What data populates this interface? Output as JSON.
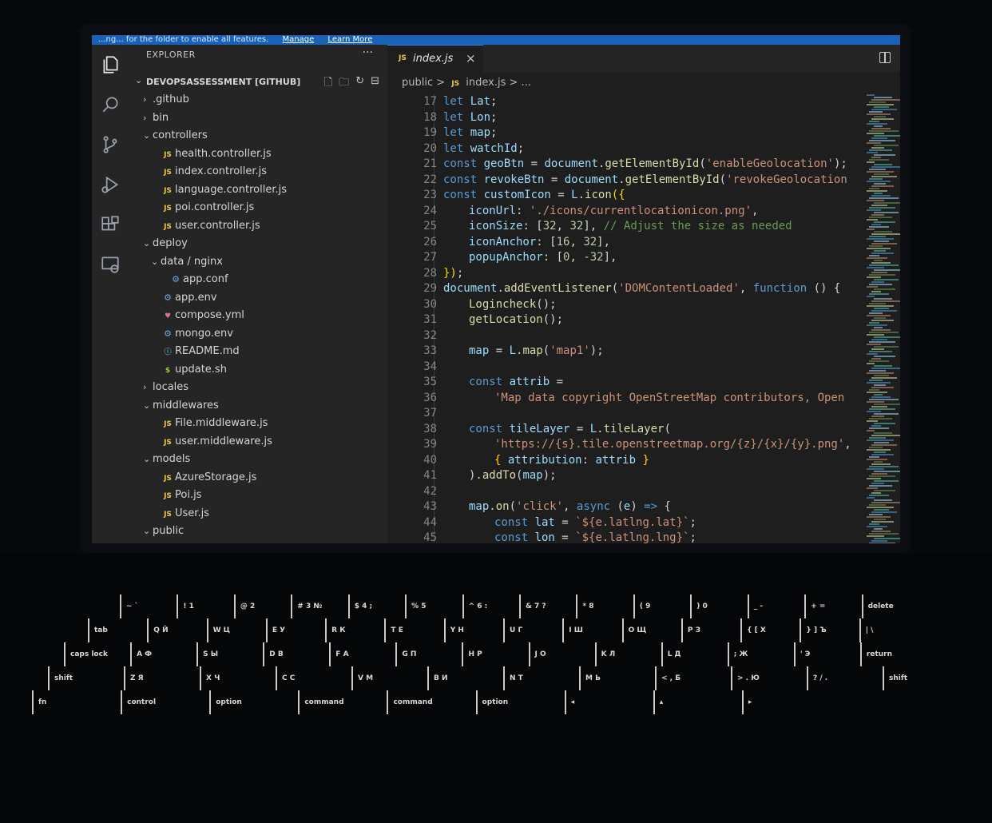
{
  "notice": {
    "message": "...ng... for the folder to enable all features.",
    "manage_link": "Manage",
    "learn_link": "Learn More"
  },
  "activity_bar": {
    "icons": [
      "files-icon",
      "search-icon",
      "source-control-icon",
      "run-debug-icon",
      "extensions-icon",
      "remote-explorer-icon"
    ]
  },
  "explorer": {
    "title": "EXPLORER",
    "more": "···",
    "repo": "DEVOPSASSESSMENT [GITHUB]",
    "tree": [
      {
        "depth": 1,
        "chevron": "›",
        "icon": "",
        "label": ".github"
      },
      {
        "depth": 1,
        "chevron": "›",
        "icon": "",
        "label": "bin"
      },
      {
        "depth": 1,
        "chevron": "⌄",
        "icon": "",
        "label": "controllers"
      },
      {
        "depth": 2,
        "chevron": "",
        "icon": "JS",
        "label": "health.controller.js"
      },
      {
        "depth": 2,
        "chevron": "",
        "icon": "JS",
        "label": "index.controller.js"
      },
      {
        "depth": 2,
        "chevron": "",
        "icon": "JS",
        "label": "language.controller.js"
      },
      {
        "depth": 2,
        "chevron": "",
        "icon": "JS",
        "label": "poi.controller.js"
      },
      {
        "depth": 2,
        "chevron": "",
        "icon": "JS",
        "label": "user.controller.js"
      },
      {
        "depth": 1,
        "chevron": "⌄",
        "icon": "",
        "label": "deploy"
      },
      {
        "depth": 2,
        "chevron": "⌄",
        "icon": "",
        "label": "data / nginx"
      },
      {
        "depth": 3,
        "chevron": "",
        "icon": "⚙",
        "label": "app.conf"
      },
      {
        "depth": 2,
        "chevron": "",
        "icon": "⚙",
        "label": "app.env"
      },
      {
        "depth": 2,
        "chevron": "",
        "icon": "♥",
        "label": "compose.yml"
      },
      {
        "depth": 2,
        "chevron": "",
        "icon": "⚙",
        "label": "mongo.env"
      },
      {
        "depth": 2,
        "chevron": "",
        "icon": "ⓘ",
        "label": "README.md"
      },
      {
        "depth": 2,
        "chevron": "",
        "icon": "$",
        "label": "update.sh"
      },
      {
        "depth": 1,
        "chevron": "›",
        "icon": "",
        "label": "locales"
      },
      {
        "depth": 1,
        "chevron": "⌄",
        "icon": "",
        "label": "middlewares"
      },
      {
        "depth": 2,
        "chevron": "",
        "icon": "JS",
        "label": "File.middleware.js"
      },
      {
        "depth": 2,
        "chevron": "",
        "icon": "JS",
        "label": "user.middleware.js"
      },
      {
        "depth": 1,
        "chevron": "⌄",
        "icon": "",
        "label": "models"
      },
      {
        "depth": 2,
        "chevron": "",
        "icon": "JS",
        "label": "AzureStorage.js"
      },
      {
        "depth": 2,
        "chevron": "",
        "icon": "JS",
        "label": "Poi.js"
      },
      {
        "depth": 2,
        "chevron": "",
        "icon": "JS",
        "label": "User.js"
      },
      {
        "depth": 1,
        "chevron": "⌄",
        "icon": "",
        "label": "public"
      }
    ]
  },
  "editor": {
    "tab": {
      "icon": "JS",
      "name": "index.js",
      "close": "×"
    },
    "breadcrumb": {
      "folder": "public",
      "sep": ">",
      "icon": "JS",
      "file": "index.js",
      "more": "> ..."
    },
    "lines": [
      {
        "n": "17",
        "indent": 0,
        "tokens": [
          [
            "kw",
            "let "
          ],
          [
            "var",
            "Lat"
          ],
          [
            "",
            "; "
          ]
        ]
      },
      {
        "n": "18",
        "indent": 0,
        "tokens": [
          [
            "kw",
            "let "
          ],
          [
            "var",
            "Lon"
          ],
          [
            "",
            ";"
          ]
        ]
      },
      {
        "n": "19",
        "indent": 0,
        "tokens": [
          [
            "kw",
            "let "
          ],
          [
            "var",
            "map"
          ],
          [
            "",
            ";"
          ]
        ]
      },
      {
        "n": "20",
        "indent": 0,
        "tokens": [
          [
            "kw",
            "let "
          ],
          [
            "var",
            "watchId"
          ],
          [
            "",
            ";"
          ]
        ]
      },
      {
        "n": "21",
        "indent": 0,
        "tokens": [
          [
            "kw",
            "const "
          ],
          [
            "var",
            "geoBtn"
          ],
          [
            "",
            " = "
          ],
          [
            "var",
            "document"
          ],
          [
            "",
            "."
          ],
          [
            "fn",
            "getElementById"
          ],
          [
            "",
            "("
          ],
          [
            "str",
            "'enableGeolocation'"
          ],
          [
            "",
            ");"
          ]
        ]
      },
      {
        "n": "22",
        "indent": 0,
        "tokens": [
          [
            "kw",
            "const "
          ],
          [
            "var",
            "revokeBtn"
          ],
          [
            "",
            " = "
          ],
          [
            "var",
            "document"
          ],
          [
            "",
            "."
          ],
          [
            "fn",
            "getElementById"
          ],
          [
            "",
            "("
          ],
          [
            "str",
            "'revokeGeolocation"
          ]
        ]
      },
      {
        "n": "23",
        "indent": 0,
        "tokens": [
          [
            "kw",
            "const "
          ],
          [
            "var",
            "customIcon"
          ],
          [
            "",
            " = "
          ],
          [
            "var",
            "L"
          ],
          [
            "",
            "."
          ],
          [
            "fn",
            "icon"
          ],
          [
            "punc",
            "({"
          ]
        ]
      },
      {
        "n": "24",
        "indent": 1,
        "tokens": [
          [
            "var",
            "iconUrl"
          ],
          [
            "",
            ": "
          ],
          [
            "str",
            "'./icons/currentlocationicon.png'"
          ],
          [
            "",
            ","
          ]
        ]
      },
      {
        "n": "25",
        "indent": 1,
        "tokens": [
          [
            "var",
            "iconSize"
          ],
          [
            "",
            ": "
          ],
          [
            "",
            "["
          ],
          [
            "num",
            "32"
          ],
          [
            "",
            ", "
          ],
          [
            "num",
            "32"
          ],
          [
            "",
            "], "
          ],
          [
            "cm",
            "// Adjust the size as needed"
          ]
        ]
      },
      {
        "n": "26",
        "indent": 1,
        "tokens": [
          [
            "var",
            "iconAnchor"
          ],
          [
            "",
            ": ["
          ],
          [
            "num",
            "16"
          ],
          [
            "",
            ", "
          ],
          [
            "num",
            "32"
          ],
          [
            "",
            "],"
          ]
        ]
      },
      {
        "n": "27",
        "indent": 1,
        "tokens": [
          [
            "var",
            "popupAnchor"
          ],
          [
            "",
            ": ["
          ],
          [
            "num",
            "0"
          ],
          [
            "",
            ", "
          ],
          [
            "num",
            "-32"
          ],
          [
            "",
            "],"
          ]
        ]
      },
      {
        "n": "28",
        "indent": 0,
        "tokens": [
          [
            "punc",
            "})"
          ],
          [
            "",
            ";"
          ]
        ]
      },
      {
        "n": "29",
        "indent": 0,
        "tokens": [
          [
            "var",
            "document"
          ],
          [
            "",
            "."
          ],
          [
            "fn",
            "addEventListener"
          ],
          [
            "",
            "("
          ],
          [
            "str",
            "'DOMContentLoaded'"
          ],
          [
            "",
            ", "
          ],
          [
            "kw",
            "function"
          ],
          [
            "",
            " () {"
          ]
        ]
      },
      {
        "n": "30",
        "indent": 1,
        "tokens": [
          [
            "fn",
            "Logincheck"
          ],
          [
            "",
            "();"
          ]
        ]
      },
      {
        "n": "31",
        "indent": 1,
        "tokens": [
          [
            "fn",
            "getLocation"
          ],
          [
            "",
            "();"
          ]
        ]
      },
      {
        "n": "32",
        "indent": 0,
        "tokens": []
      },
      {
        "n": "33",
        "indent": 1,
        "tokens": [
          [
            "var",
            "map"
          ],
          [
            "",
            " = "
          ],
          [
            "var",
            "L"
          ],
          [
            "",
            "."
          ],
          [
            "fn",
            "map"
          ],
          [
            "",
            "("
          ],
          [
            "str",
            "'map1'"
          ],
          [
            "",
            ");"
          ]
        ]
      },
      {
        "n": "34",
        "indent": 0,
        "tokens": []
      },
      {
        "n": "35",
        "indent": 1,
        "tokens": [
          [
            "kw",
            "const "
          ],
          [
            "var",
            "attrib"
          ],
          [
            "",
            " ="
          ]
        ]
      },
      {
        "n": "36",
        "indent": 2,
        "tokens": [
          [
            "str",
            "'Map data copyright OpenStreetMap contributors, Open"
          ]
        ]
      },
      {
        "n": "37",
        "indent": 0,
        "tokens": []
      },
      {
        "n": "38",
        "indent": 1,
        "tokens": [
          [
            "kw",
            "const "
          ],
          [
            "var",
            "tileLayer"
          ],
          [
            "",
            " = "
          ],
          [
            "var",
            "L"
          ],
          [
            "",
            "."
          ],
          [
            "fn",
            "tileLayer"
          ],
          [
            "",
            "("
          ]
        ]
      },
      {
        "n": "39",
        "indent": 2,
        "tokens": [
          [
            "str",
            "'https://{s}.tile.openstreetmap.org/{z}/{x}/{y}.png'"
          ],
          [
            "",
            ","
          ]
        ]
      },
      {
        "n": "40",
        "indent": 2,
        "tokens": [
          [
            "punc",
            "{ "
          ],
          [
            "var",
            "attribution"
          ],
          [
            "",
            ": "
          ],
          [
            "var",
            "attrib"
          ],
          [
            "punc",
            " }"
          ]
        ]
      },
      {
        "n": "41",
        "indent": 1,
        "tokens": [
          [
            "",
            ")."
          ],
          [
            "fn",
            "addTo"
          ],
          [
            "",
            "("
          ],
          [
            "var",
            "map"
          ],
          [
            "",
            ");"
          ]
        ]
      },
      {
        "n": "42",
        "indent": 0,
        "tokens": []
      },
      {
        "n": "43",
        "indent": 1,
        "tokens": [
          [
            "var",
            "map"
          ],
          [
            "",
            "."
          ],
          [
            "fn",
            "on"
          ],
          [
            "",
            "("
          ],
          [
            "str",
            "'click'"
          ],
          [
            "",
            ", "
          ],
          [
            "kw",
            "async "
          ],
          [
            "",
            "("
          ],
          [
            "var",
            "e"
          ],
          [
            "",
            ") "
          ],
          [
            "kw",
            "=>"
          ],
          [
            "",
            " {"
          ]
        ]
      },
      {
        "n": "44",
        "indent": 2,
        "tokens": [
          [
            "kw",
            "const "
          ],
          [
            "var",
            "lat"
          ],
          [
            "",
            " = "
          ],
          [
            "str",
            "`${e.latlng.lat}`"
          ],
          [
            "",
            ";"
          ]
        ]
      },
      {
        "n": "45",
        "indent": 2,
        "tokens": [
          [
            "kw",
            "const "
          ],
          [
            "var",
            "lon"
          ],
          [
            "",
            " = "
          ],
          [
            "str",
            "`${e.latlng.lng}`"
          ],
          [
            "",
            ";"
          ]
        ]
      }
    ]
  },
  "keyboard": {
    "rows": [
      [
        "~ `",
        "! 1",
        "@ 2",
        "# 3 №",
        "$ 4 ;",
        "% 5",
        "^ 6 :",
        "& 7 ?",
        "* 8",
        "( 9",
        ") 0",
        "_ -",
        "+ =",
        "delete"
      ],
      [
        "tab",
        "Q Й",
        "W Ц",
        "E У",
        "R К",
        "T Е",
        "Y Н",
        "U Г",
        "I Ш",
        "O Щ",
        "P З",
        "{ [ Х",
        "} ] Ъ",
        "| \\"
      ],
      [
        "caps lock",
        "A Ф",
        "S Ы",
        "D В",
        "F А",
        "G П",
        "H Р",
        "J О",
        "K Л",
        "L Д",
        "; Ж",
        "' Э",
        "return"
      ],
      [
        "shift",
        "Z Я",
        "X Ч",
        "C С",
        "V М",
        "B И",
        "N Т",
        "M Ь",
        "< , Б",
        "> . Ю",
        "? / .",
        "shift"
      ],
      [
        "fn",
        "control",
        "option",
        "command",
        "command",
        "option",
        "◂",
        "▴",
        "▸"
      ]
    ]
  },
  "colors": {
    "editor_bg": "#1e1e1e",
    "sidebar_bg": "#252526",
    "accent": "#1a62b8",
    "js_icon": "#e8c94a"
  }
}
